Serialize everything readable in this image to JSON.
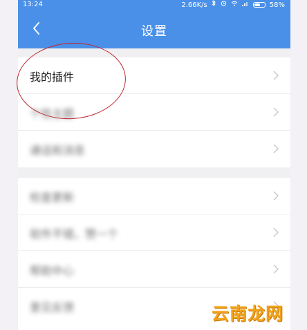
{
  "status_bar": {
    "time": "13:24",
    "network_speed": "2.66K/s",
    "battery_percent": "58%",
    "battery_level": 0.58,
    "icons": [
      "bluetooth-icon",
      "alarm-icon",
      "wifi-icon",
      "signal-icon",
      "battery-icon"
    ]
  },
  "header": {
    "title": "设置",
    "back_icon": "chevron-left-icon",
    "background_color": "#4a90e8"
  },
  "settings": {
    "groups": [
      {
        "items": [
          {
            "label": "我的插件",
            "blurred": false
          },
          {
            "label": "个性主题",
            "blurred": true
          },
          {
            "label": "通话和消息",
            "blurred": true
          }
        ]
      },
      {
        "items": [
          {
            "label": "检查更新",
            "blurred": true
          },
          {
            "label": "软件不错，赞一个",
            "blurred": true
          },
          {
            "label": "帮助中心",
            "blurred": true
          },
          {
            "label": "意见反馈",
            "blurred": true
          }
        ]
      }
    ]
  },
  "annotation": {
    "color": "#c0262f"
  },
  "watermark": {
    "text": "云南龙网",
    "color": "#f2a21a"
  }
}
